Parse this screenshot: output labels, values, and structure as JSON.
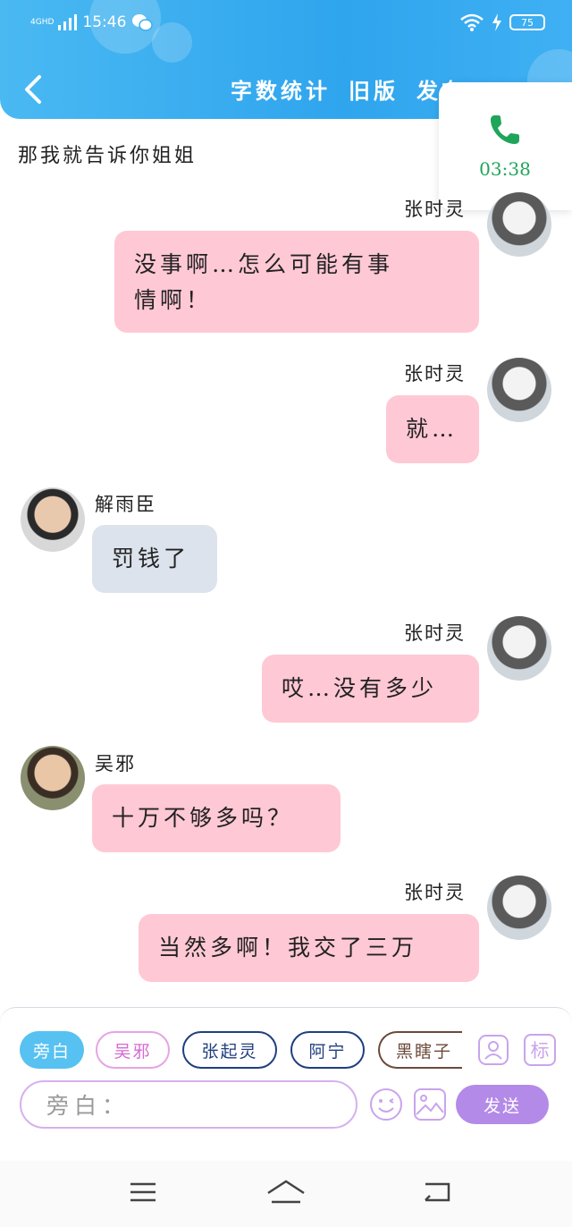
{
  "status": {
    "network": "4GHD",
    "time": "15:46",
    "battery": "75"
  },
  "header": {
    "tabs": [
      "字数统计",
      "旧版",
      "发布"
    ],
    "more": "…"
  },
  "call": {
    "timer": "03:38"
  },
  "narration_top": "那我就告诉你姐姐",
  "messages": [
    {
      "side": "right",
      "name": "张时灵",
      "text_line1": "没事啊…怎么可能有事",
      "text_line2": "情啊！"
    },
    {
      "side": "right",
      "name": "张时灵",
      "text": "就…"
    },
    {
      "side": "left",
      "name": "解雨臣",
      "text": "罚钱了"
    },
    {
      "side": "right",
      "name": "张时灵",
      "text": "哎…没有多少"
    },
    {
      "side": "left",
      "name": "吴邪",
      "text": "十万不够多吗？"
    },
    {
      "side": "right",
      "name": "张时灵",
      "text": "当然多啊！我交了三万"
    }
  ],
  "composer": {
    "chips": [
      "旁白",
      "吴邪",
      "张起灵",
      "阿宁",
      "黑瞎子"
    ],
    "tag_label": "标",
    "placeholder": "旁白：",
    "send_label": "发送"
  },
  "colors": {
    "header": "#2fa5ee",
    "pink_bubble": "#ffc8d5",
    "gray_bubble": "#dde3ec",
    "send": "#b38ae8",
    "call_green": "#1fa55a"
  }
}
